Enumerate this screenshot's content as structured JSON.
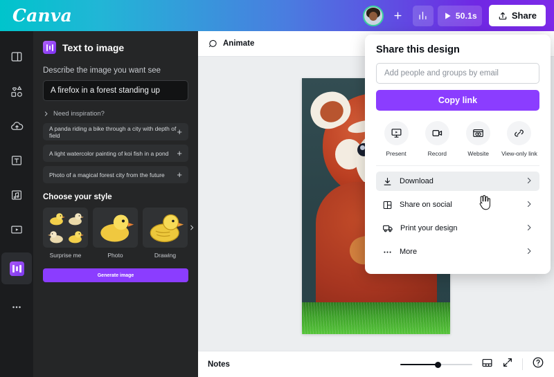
{
  "topbar": {
    "logo": "Canva",
    "avatar_name": "user-avatar",
    "add_member_label": "+",
    "stats_icon": "bar-chart-icon",
    "play_icon": "play-icon",
    "duration": "50.1s",
    "share_label": "Share"
  },
  "rail": {
    "items": [
      {
        "name": "design",
        "icon": "layout-icon"
      },
      {
        "name": "elements",
        "icon": "shapes-icon"
      },
      {
        "name": "uploads",
        "icon": "cloud-upload-icon"
      },
      {
        "name": "text",
        "icon": "text-t-icon"
      },
      {
        "name": "audio",
        "icon": "music-note-icon"
      },
      {
        "name": "videos",
        "icon": "video-box-icon"
      },
      {
        "name": "apps",
        "icon": "apps-tile-icon"
      },
      {
        "name": "more",
        "icon": "ellipsis-icon"
      }
    ]
  },
  "panel": {
    "title": "Text to image",
    "icon": "text-to-image-icon",
    "describe_label": "Describe the image you want see",
    "prompt_value": "A firefox in a forest standing up",
    "prompt_placeholder": "Describe the image you want see",
    "inspiration_label": "Need inspiration?",
    "suggestions": [
      "A panda riding a bike through a city with depth of field",
      "A light watercolor painting of koi fish in a pond",
      "Photo of a magical forest city from the future"
    ],
    "style_section_title": "Choose your style",
    "styles": [
      {
        "label": "Surprise me",
        "thumb": "four-ducks-grid"
      },
      {
        "label": "Photo",
        "thumb": "photo-duck"
      },
      {
        "label": "Drawing",
        "thumb": "drawing-duck"
      }
    ],
    "carousel_next_icon": "chevron-right-icon",
    "generate_label": "Generate image"
  },
  "stage": {
    "animate_label": "Animate",
    "animate_icon": "animate-icon",
    "design_alt": "red-panda-in-forest-image"
  },
  "bottombar": {
    "notes_label": "Notes",
    "zoom_value": "54",
    "pages_icon": "pages-grid-icon",
    "fullscreen_icon": "expand-arrows-icon",
    "help_icon": "help-question-icon"
  },
  "share_dialog": {
    "title": "Share this design",
    "email_placeholder": "Add people and groups by email",
    "email_value": "",
    "copy_link_label": "Copy link",
    "quick_actions": [
      {
        "label": "Present",
        "icon": "present-screen-icon"
      },
      {
        "label": "Record",
        "icon": "record-camera-icon"
      },
      {
        "label": "Website",
        "icon": "website-browser-icon"
      },
      {
        "label": "View-only link",
        "icon": "link-chain-icon"
      }
    ],
    "menu_items": [
      {
        "label": "Download",
        "icon": "download-icon",
        "hovered": true
      },
      {
        "label": "Share on social",
        "icon": "social-grid-icon",
        "hovered": false
      },
      {
        "label": "Print your design",
        "icon": "print-truck-icon",
        "hovered": false
      },
      {
        "label": "More",
        "icon": "ellipsis-icon",
        "hovered": false
      }
    ],
    "chevron_icon": "chevron-right-icon"
  },
  "colors": {
    "brand_purple": "#8b3dff",
    "header_cyan": "#00c4cc",
    "header_purple": "#7d2ae8",
    "panel_bg": "#252627",
    "stage_bg": "#eceef0",
    "avatar_ring": "#3ad29f"
  },
  "cursor": {
    "type": "pointing-hand-cursor"
  }
}
